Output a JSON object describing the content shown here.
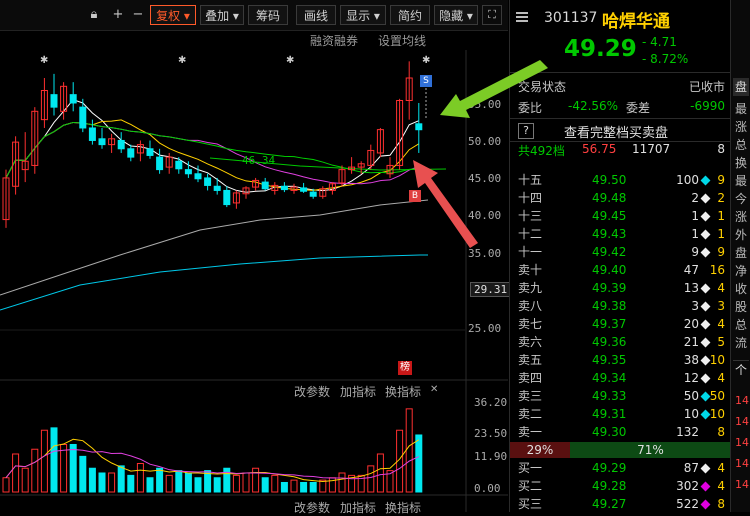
{
  "toolbar": {
    "fuquan": "复权",
    "diejia": "叠加",
    "choumа": "筹码",
    "huaxian": "画线",
    "xianshi": "显示",
    "jianyue": "简约",
    "yincang": "隐藏"
  },
  "subbar": {
    "rongzi": "融资融券",
    "shezhi": "设置均线"
  },
  "chart": {
    "price_labels": [
      "55.00",
      "50.00",
      "45.00",
      "40.00",
      "35.00",
      "29.31",
      "25.00"
    ],
    "ma_label": "46.34",
    "buttons": [
      "改参数",
      "加指标",
      "换指标"
    ],
    "bang": "榜",
    "vol_labels": [
      "36.20",
      "23.50",
      "11.90",
      "0.00"
    ],
    "bottom_buttons": [
      "改参数",
      "加指标",
      "换指标"
    ],
    "s_mark": "S",
    "b_mark": "B"
  },
  "chart_data": {
    "type": "candlestick",
    "y_axis": [
      25,
      55
    ],
    "candles": [
      [
        38.5,
        44.5,
        37.5,
        43.5
      ],
      [
        42.5,
        48.5,
        41.5,
        47.8
      ],
      [
        44.5,
        49.0,
        43.0,
        45.5
      ],
      [
        45.0,
        52.0,
        44.0,
        51.5
      ],
      [
        50.5,
        55.5,
        49.5,
        54.0
      ],
      [
        53.5,
        56.0,
        51.0,
        52.0
      ],
      [
        51.5,
        55.0,
        50.5,
        54.5
      ],
      [
        53.5,
        55.0,
        51.5,
        52.5
      ],
      [
        52.0,
        53.0,
        49.0,
        49.5
      ],
      [
        49.5,
        50.5,
        47.5,
        48.0
      ],
      [
        48.2,
        49.5,
        47.0,
        47.5
      ],
      [
        47.5,
        48.8,
        46.5,
        48.2
      ],
      [
        48.0,
        49.0,
        46.5,
        47.0
      ],
      [
        47.0,
        47.5,
        45.5,
        46.0
      ],
      [
        46.5,
        48.0,
        45.5,
        47.5
      ],
      [
        47.0,
        48.0,
        45.8,
        46.2
      ],
      [
        46.0,
        47.0,
        44.0,
        44.5
      ],
      [
        44.8,
        46.5,
        44.0,
        46.0
      ],
      [
        45.5,
        46.0,
        44.0,
        44.6
      ],
      [
        44.5,
        45.5,
        43.5,
        44.0
      ],
      [
        44.0,
        45.0,
        43.0,
        43.4
      ],
      [
        43.5,
        44.0,
        42.0,
        42.6
      ],
      [
        42.5,
        43.5,
        41.5,
        42.0
      ],
      [
        42.0,
        42.5,
        40.0,
        40.3
      ],
      [
        40.5,
        42.0,
        39.8,
        41.7
      ],
      [
        41.6,
        42.5,
        41.0,
        42.3
      ],
      [
        42.4,
        43.5,
        42.0,
        43.2
      ],
      [
        43.0,
        43.5,
        42.0,
        42.2
      ],
      [
        42.0,
        43.0,
        41.5,
        42.6
      ],
      [
        42.5,
        43.0,
        41.8,
        42.1
      ],
      [
        42.0,
        42.8,
        41.6,
        42.4
      ],
      [
        42.3,
        42.9,
        41.7,
        41.9
      ],
      [
        41.8,
        42.2,
        41.0,
        41.3
      ],
      [
        41.3,
        42.5,
        41.0,
        42.2
      ],
      [
        42.0,
        43.0,
        41.5,
        42.8
      ],
      [
        42.9,
        45.0,
        42.5,
        44.5
      ],
      [
        44.5,
        46.0,
        44.0,
        44.8
      ],
      [
        44.8,
        45.5,
        44.0,
        45.2
      ],
      [
        45.0,
        47.5,
        44.5,
        46.8
      ],
      [
        46.5,
        49.5,
        46.0,
        49.3
      ],
      [
        44.0,
        46.0,
        43.5,
        45.0
      ],
      [
        45.0,
        53.0,
        44.5,
        52.8
      ],
      [
        52.8,
        57.5,
        50.5,
        55.5
      ],
      [
        50.0,
        52.5,
        46.5,
        49.29
      ]
    ],
    "volumes": [
      6,
      16,
      10,
      18,
      26,
      27,
      20,
      20,
      15,
      10,
      8,
      8,
      11,
      7,
      12,
      6,
      10,
      7,
      9,
      8,
      6,
      9,
      6,
      10,
      7,
      8,
      10,
      6,
      7,
      4,
      5,
      4,
      4,
      5,
      6,
      8,
      7,
      7,
      11,
      16,
      9,
      26,
      35,
      24
    ]
  },
  "quote": {
    "code": "301137",
    "name": "哈焊华通",
    "price": "49.29",
    "change": "4.71",
    "pct": "8.72%"
  },
  "status": {
    "label": "交易状态",
    "value": "已收市"
  },
  "ratio": {
    "weibi_label": "委比",
    "weibi": "-42.56%",
    "weicha_label": "委差",
    "weicha": "-6990"
  },
  "full_book": "查看完整档买卖盘",
  "book_header": {
    "label": "共492档",
    "price": "56.75",
    "vol": "11707",
    "cnt": "8"
  },
  "asks": [
    {
      "label": "十五",
      "price": "49.50",
      "vol": "100",
      "cnt": "9",
      "dot": "#00d8e8"
    },
    {
      "label": "十四",
      "price": "49.48",
      "vol": "2",
      "cnt": "2",
      "dot": "#f0f0f0"
    },
    {
      "label": "十三",
      "price": "49.45",
      "vol": "1",
      "cnt": "1",
      "dot": "#f0f0f0"
    },
    {
      "label": "十二",
      "price": "49.43",
      "vol": "1",
      "cnt": "1",
      "dot": "#f0f0f0"
    },
    {
      "label": "十一",
      "price": "49.42",
      "vol": "9",
      "cnt": "9",
      "dot": "#f0f0f0"
    },
    {
      "label": "卖十",
      "price": "49.40",
      "vol": "47",
      "cnt": "16",
      "dot": ""
    },
    {
      "label": "卖九",
      "price": "49.39",
      "vol": "13",
      "cnt": "4",
      "dot": "#f0f0f0"
    },
    {
      "label": "卖八",
      "price": "49.38",
      "vol": "3",
      "cnt": "3",
      "dot": "#f0f0f0"
    },
    {
      "label": "卖七",
      "price": "49.37",
      "vol": "20",
      "cnt": "4",
      "dot": "#f0f0f0"
    },
    {
      "label": "卖六",
      "price": "49.36",
      "vol": "21",
      "cnt": "5",
      "dot": "#f0f0f0"
    },
    {
      "label": "卖五",
      "price": "49.35",
      "vol": "38",
      "cnt": "10",
      "dot": "#f0f0f0"
    },
    {
      "label": "卖四",
      "price": "49.34",
      "vol": "12",
      "cnt": "4",
      "dot": "#f0f0f0"
    },
    {
      "label": "卖三",
      "price": "49.33",
      "vol": "50",
      "cnt": "50",
      "dot": "#00d8e8"
    },
    {
      "label": "卖二",
      "price": "49.31",
      "vol": "10",
      "cnt": "10",
      "dot": "#00d8e8"
    },
    {
      "label": "卖一",
      "price": "49.30",
      "vol": "132",
      "cnt": "8",
      "dot": ""
    }
  ],
  "balance": {
    "sell": "29%",
    "buy": "71%"
  },
  "bids": [
    {
      "label": "买一",
      "price": "49.29",
      "vol": "87",
      "cnt": "4",
      "dot": "#f0f0f0"
    },
    {
      "label": "买二",
      "price": "49.28",
      "vol": "302",
      "cnt": "4",
      "dot": "#e000e0"
    },
    {
      "label": "买三",
      "price": "49.27",
      "vol": "522",
      "cnt": "8",
      "dot": "#e000e0"
    }
  ],
  "side": {
    "tab": "盘",
    "chars": [
      "最",
      "涨",
      "总",
      "换",
      "最",
      "今",
      "涨",
      "外",
      "盘",
      "净",
      "收",
      "股",
      "总",
      "流"
    ],
    "tab2": "个",
    "nums": [
      "14",
      "14",
      "14",
      "14",
      "14"
    ]
  }
}
